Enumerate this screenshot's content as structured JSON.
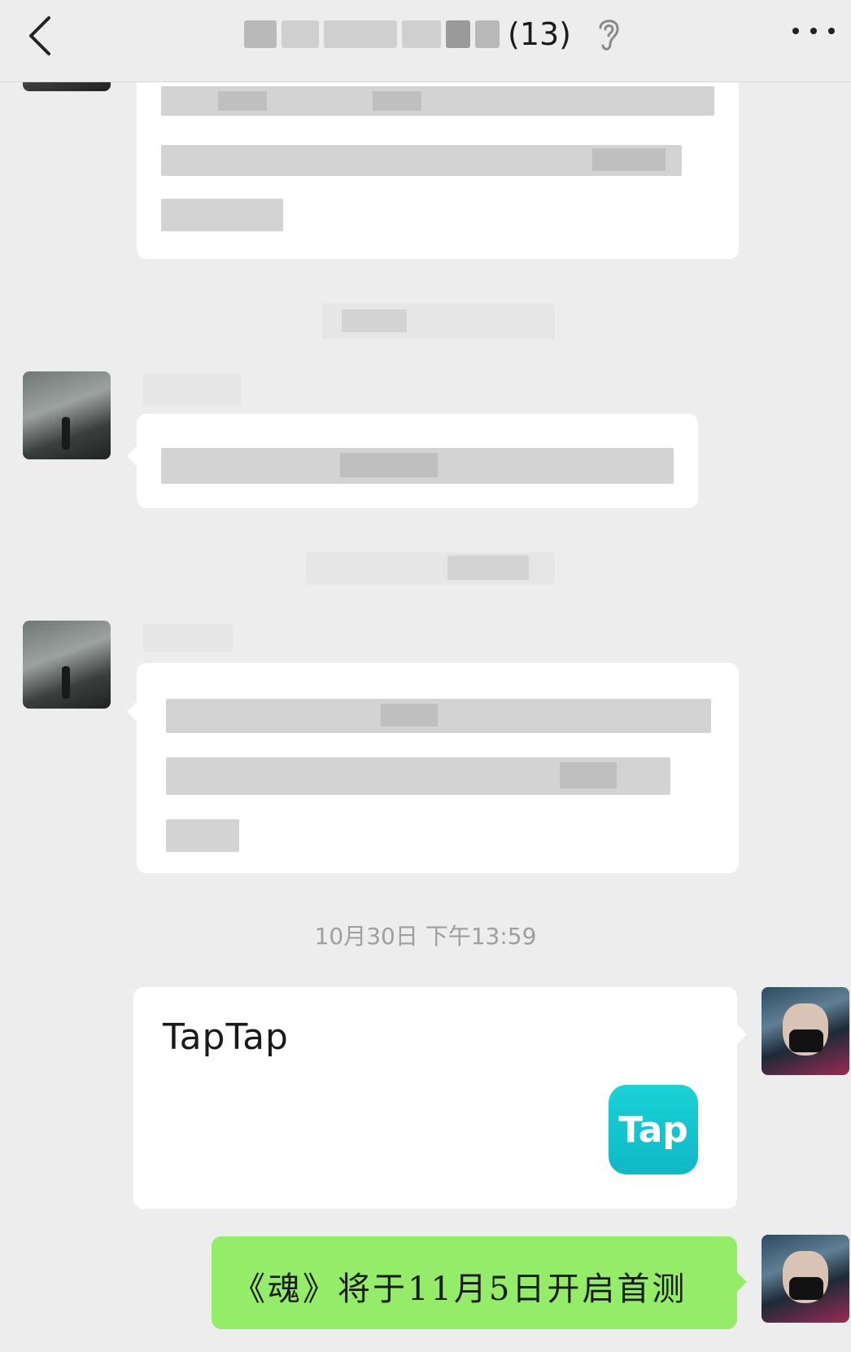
{
  "header": {
    "title_count": "(13)",
    "back_icon": "chevron-left-icon",
    "ear_icon": "ear-icon",
    "more_icon": "more-dots-icon"
  },
  "timestamps": {
    "latest": "10月30日  下午13:59"
  },
  "messages": {
    "link_card": {
      "title": "TapTap",
      "logo_text": "Tap"
    },
    "green_text": "《魂》将于11月5日开启首测"
  },
  "colors": {
    "background": "#ededed",
    "bubble_white": "#ffffff",
    "bubble_green": "#95ec69",
    "taptap_teal": "#15c5d0"
  }
}
